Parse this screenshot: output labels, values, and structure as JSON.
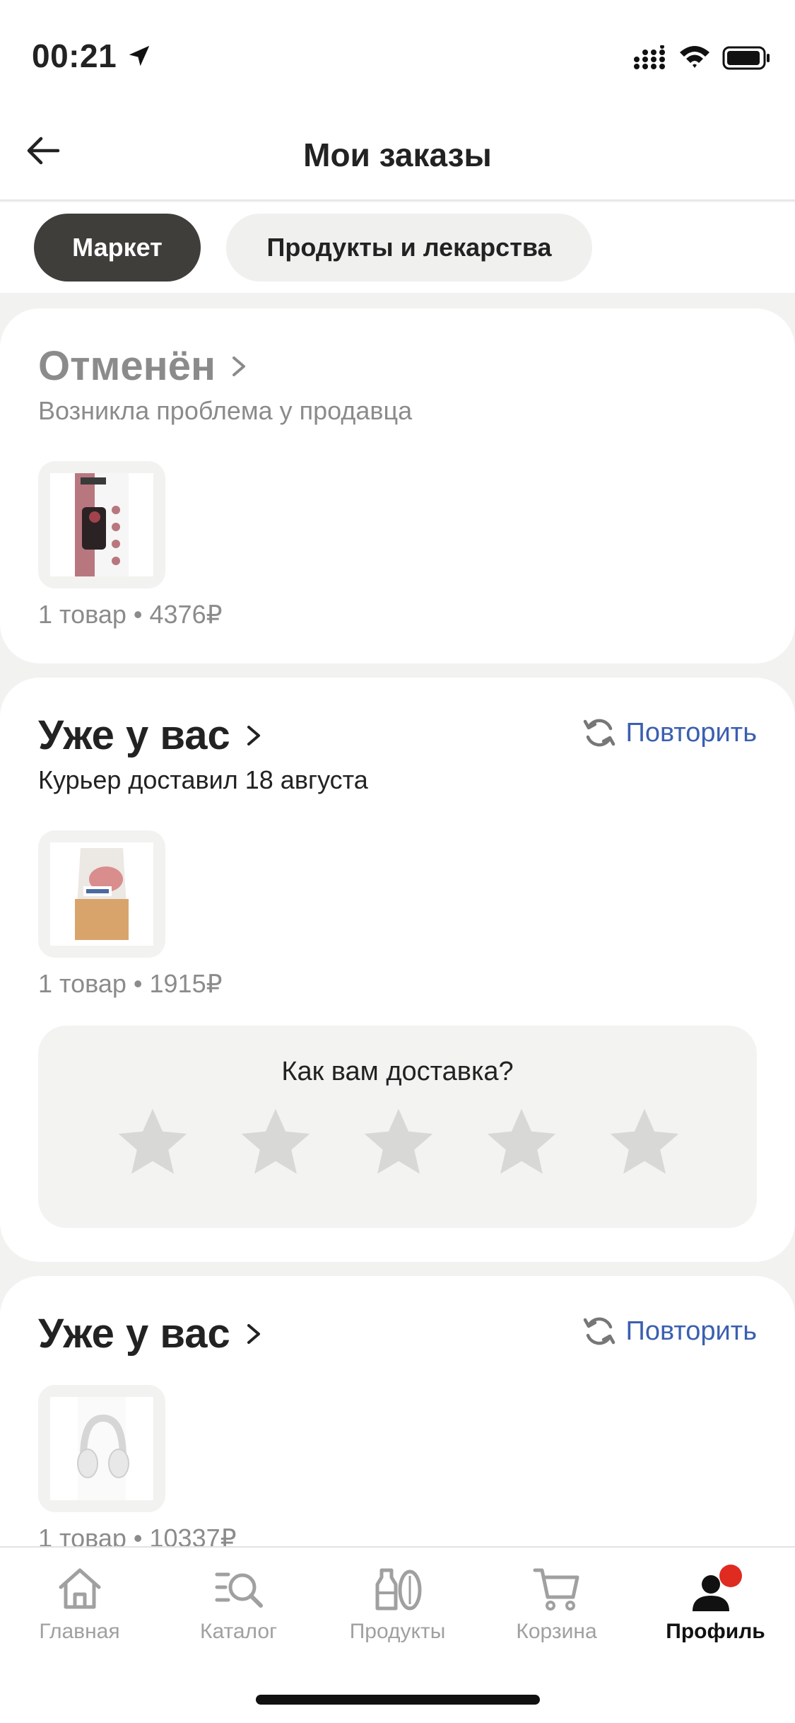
{
  "status_bar": {
    "time": "00:21"
  },
  "header": {
    "title": "Мои заказы"
  },
  "tabs": [
    {
      "label": "Маркет",
      "active": true
    },
    {
      "label": "Продукты и лекарства",
      "active": false
    }
  ],
  "orders": [
    {
      "status": "Отменён",
      "subtitle": "Возникла проблема у продавца",
      "summary": "1 товар • 4376₽",
      "product_icon": "dog-food-bag-icon"
    },
    {
      "status": "Уже у вас",
      "subtitle": "Курьер доставил 18 августа",
      "repeat_label": "Повторить",
      "summary": "1 товар • 1915₽",
      "product_icon": "cat-food-bag-icon",
      "rating": {
        "question": "Как вам доставка?",
        "stars": 0,
        "max": 5
      }
    },
    {
      "status": "Уже у вас",
      "repeat_label": "Повторить",
      "summary": "1 товар • 10337₽",
      "product_icon": "headphones-icon"
    }
  ],
  "bottom_nav": [
    {
      "label": "Главная",
      "icon": "home-icon"
    },
    {
      "label": "Каталог",
      "icon": "catalog-search-icon"
    },
    {
      "label": "Продукты",
      "icon": "groceries-icon"
    },
    {
      "label": "Корзина",
      "icon": "cart-icon"
    },
    {
      "label": "Профиль",
      "icon": "profile-icon",
      "active": true
    }
  ],
  "colors": {
    "link": "#3b5fb0",
    "active_tab": "#3f3e3b",
    "badge": "#e02b20",
    "muted": "#8b8b8b"
  }
}
